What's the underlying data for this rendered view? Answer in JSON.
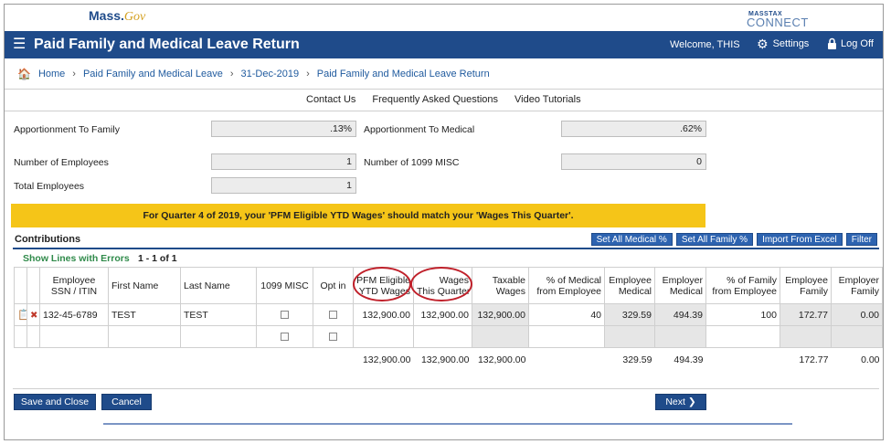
{
  "logos": {
    "mass_main": "Mass.",
    "mass_gov": "Gov",
    "masstax_small": "MASSTAX",
    "masstax_big": "CONNECT"
  },
  "header": {
    "title": "Paid Family and Medical Leave Return",
    "welcome": "Welcome, THIS",
    "settings": "Settings",
    "logoff": "Log Off"
  },
  "breadcrumb": [
    "Home",
    "Paid Family and Medical Leave",
    "31-Dec-2019",
    "Paid Family and Medical Leave Return"
  ],
  "toplinks": [
    "Contact Us",
    "Frequently Asked Questions",
    "Video Tutorials"
  ],
  "fields": {
    "apportionment_family_label": "Apportionment To Family",
    "apportionment_family_value": ".13%",
    "apportionment_medical_label": "Apportionment To Medical",
    "apportionment_medical_value": ".62%",
    "num_employees_label": "Number of Employees",
    "num_employees_value": "1",
    "num_1099_label": "Number of 1099 MISC",
    "num_1099_value": "0",
    "total_employees_label": "Total Employees",
    "total_employees_value": "1"
  },
  "banner": "For Quarter 4 of 2019, your 'PFM Eligible YTD Wages' should match your 'Wages This Quarter'.",
  "contributions": {
    "title": "Contributions",
    "buttons": [
      "Set All Medical %",
      "Set All Family %",
      "Import From Excel",
      "Filter"
    ],
    "show_errors": "Show Lines with Errors",
    "page_count": "1 - 1 of 1"
  },
  "table": {
    "headers": [
      [
        "Employee",
        "SSN / ITIN"
      ],
      [
        "First Name"
      ],
      [
        "Last Name"
      ],
      [
        "1099 MISC"
      ],
      [
        "Opt in"
      ],
      [
        "PFM Eligible",
        "YTD Wages"
      ],
      [
        "Wages",
        "This Quarter"
      ],
      [
        "Taxable",
        "Wages"
      ],
      [
        "% of Medical",
        "from Employee"
      ],
      [
        "Employee",
        "Medical"
      ],
      [
        "Employer",
        "Medical"
      ],
      [
        "% of Family",
        "from Employee"
      ],
      [
        "Employee",
        "Family"
      ],
      [
        "Employer",
        "Family"
      ]
    ],
    "row1": {
      "ssn": "132-45-6789",
      "first": "TEST",
      "last": "TEST",
      "pfm_ytd": "132,900.00",
      "wages_quarter": "132,900.00",
      "taxable": "132,900.00",
      "pct_medical": "40",
      "emp_medical": "329.59",
      "er_medical": "494.39",
      "pct_family": "100",
      "emp_family": "172.77",
      "er_family": "0.00"
    },
    "totals": {
      "pfm_ytd": "132,900.00",
      "wages_quarter": "132,900.00",
      "taxable": "132,900.00",
      "emp_medical": "329.59",
      "er_medical": "494.39",
      "emp_family": "172.77",
      "er_family": "0.00"
    }
  },
  "actions": {
    "save_close": "Save and Close",
    "cancel": "Cancel",
    "next": "Next"
  },
  "colors": {
    "brand_blue": "#1f4b8a",
    "banner_yellow": "#f5c518",
    "annotation_red": "#c0202a"
  }
}
